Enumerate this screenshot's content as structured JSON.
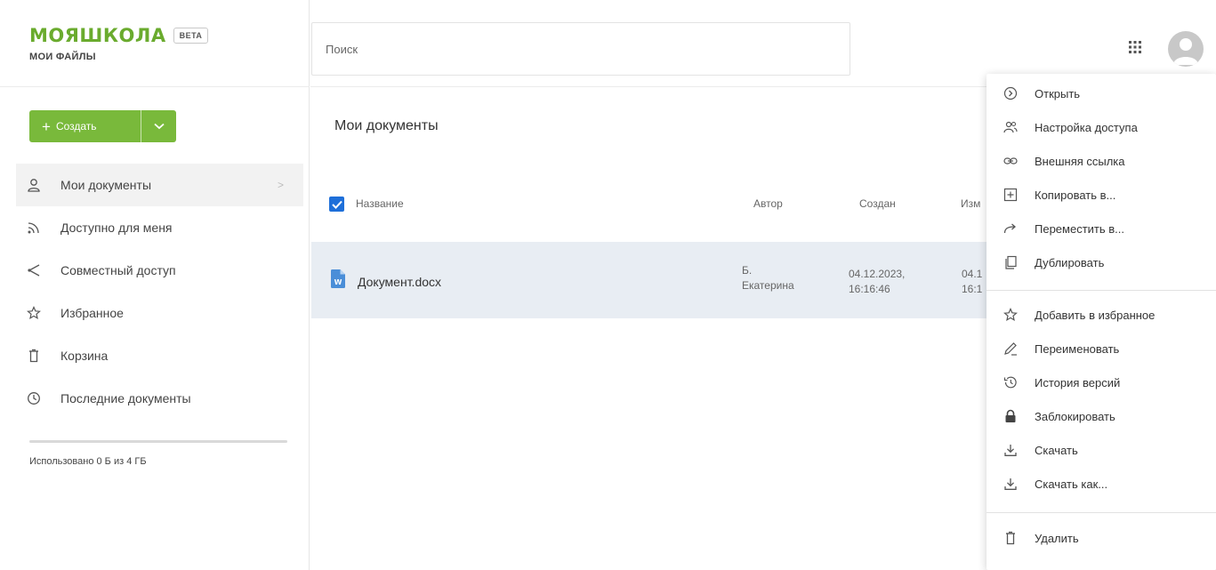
{
  "brand": {
    "logo": "МОЯШКОЛА",
    "badge": "BETA",
    "subtitle": "МОИ ФАЙЛЫ"
  },
  "create_button": {
    "label": "Создать"
  },
  "sidebar": {
    "items": [
      {
        "label": "Мои документы",
        "icon": "user-icon",
        "active": true
      },
      {
        "label": "Доступно для меня",
        "icon": "rss-icon"
      },
      {
        "label": "Совместный доступ",
        "icon": "share-icon"
      },
      {
        "label": "Избранное",
        "icon": "star-icon"
      },
      {
        "label": "Корзина",
        "icon": "trash-icon"
      },
      {
        "label": "Последние документы",
        "icon": "clock-icon"
      }
    ],
    "usage": "Использовано 0 Б из 4 ГБ"
  },
  "search": {
    "placeholder": "Поиск"
  },
  "main": {
    "title": "Мои документы",
    "columns": {
      "name": "Название",
      "author": "Автор",
      "created": "Создан",
      "modified": "Изм"
    },
    "rows": [
      {
        "name": "Документ.docx",
        "author_line1": "Б.",
        "author_line2": "Екатерина",
        "created_line1": "04.12.2023,",
        "created_line2": "16:16:46",
        "modified_line1": "04.1",
        "modified_line2": "16:1"
      }
    ]
  },
  "context_menu": {
    "items": [
      {
        "label": "Открыть",
        "icon": "open-icon"
      },
      {
        "label": "Настройка доступа",
        "icon": "people-icon"
      },
      {
        "label": "Внешняя ссылка",
        "icon": "link-icon"
      },
      {
        "label": "Копировать в...",
        "icon": "copy-to-icon"
      },
      {
        "label": "Переместить в...",
        "icon": "move-icon"
      },
      {
        "label": "Дублировать",
        "icon": "duplicate-icon"
      },
      {
        "label": "Добавить в избранное",
        "icon": "star-icon"
      },
      {
        "label": "Переименовать",
        "icon": "pencil-icon"
      },
      {
        "label": "История версий",
        "icon": "history-icon"
      },
      {
        "label": "Заблокировать",
        "icon": "lock-icon"
      },
      {
        "label": "Скачать",
        "icon": "download-icon"
      },
      {
        "label": "Скачать как...",
        "icon": "download-as-icon"
      },
      {
        "label": "Удалить",
        "icon": "trash-icon"
      }
    ]
  },
  "colors": {
    "brand_green": "#6aab2e",
    "button_green": "#79b93b",
    "checkbox_blue": "#1e6fd9",
    "row_selected": "#e8edf3"
  }
}
